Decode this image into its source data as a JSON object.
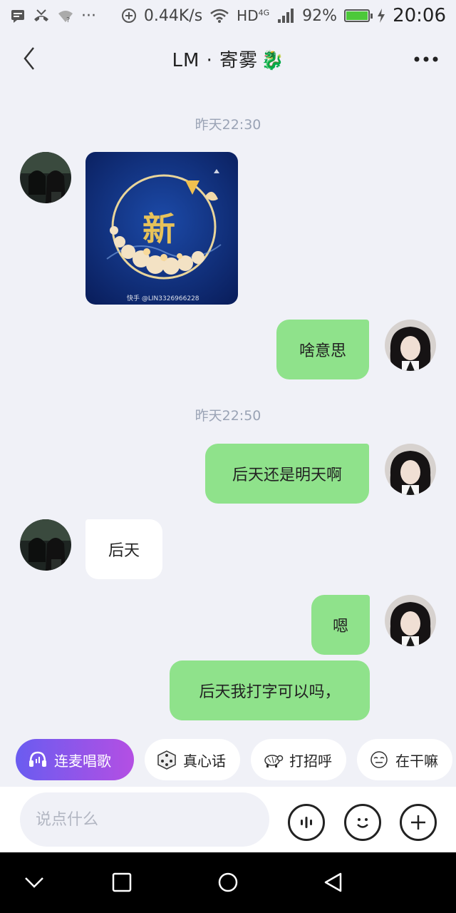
{
  "status_bar": {
    "net_speed": "0.44K/s",
    "network": "HD",
    "network_gen": "4G",
    "battery_percent": "92%",
    "battery_level": 0.92,
    "time": "20:06"
  },
  "header": {
    "title": "LM · 寄雾",
    "title_emoji": "🐉"
  },
  "messages": {
    "ts1": "昨天22:30",
    "image_caption": "快手 @LIN3326966228",
    "image_char": "新",
    "msg1": "啥意思",
    "ts2": "昨天22:50",
    "msg2": "后天还是明天啊",
    "msg3": "后天",
    "msg4": "嗯",
    "msg5": "后天我打字可以吗，"
  },
  "quick_actions": [
    {
      "label": "连麦唱歌",
      "icon": "headphones-icon"
    },
    {
      "label": "真心话",
      "icon": "dice-icon"
    },
    {
      "label": "打招呼",
      "icon": "turtle-icon"
    },
    {
      "label": "在干嘛",
      "icon": "face-icon"
    }
  ],
  "input": {
    "placeholder": "说点什么"
  },
  "colors": {
    "my_bubble": "#8fe28b",
    "their_bubble": "#ffffff",
    "background": "#f0f1f7",
    "accent_gradient_start": "#6a5cf0",
    "accent_gradient_end": "#b44fe3"
  }
}
